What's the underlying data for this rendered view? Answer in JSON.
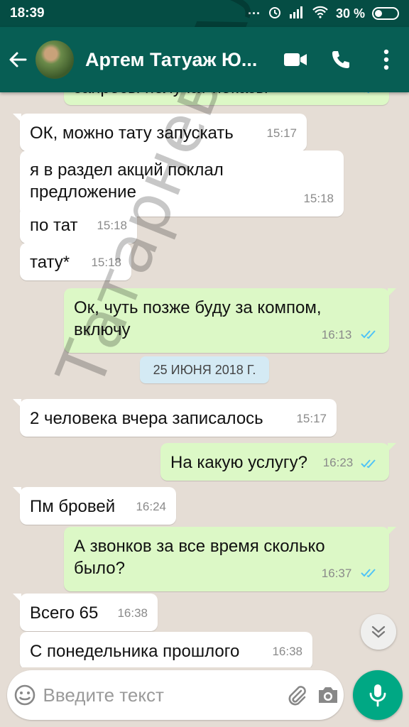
{
  "status_bar": {
    "time": "18:39",
    "battery": "30 %"
  },
  "header": {
    "contact_name": "Артем Татуаж Ю..."
  },
  "partial_top_message": "запросы получат показы",
  "messages": [
    {
      "text": "ОК, можно тату запускать",
      "time": "15:17"
    },
    {
      "text": "я в раздел акций поклал предложение",
      "time": "15:18"
    },
    {
      "text": "по тат",
      "time": "15:18"
    },
    {
      "text": "тату*",
      "time": "15:18"
    },
    {
      "text": "Ок, чуть позже буду за компом, включу",
      "time": "16:13"
    },
    {
      "text": "2 человека вчера записалось",
      "time": "15:17"
    },
    {
      "text": "На какую услугу?",
      "time": "16:23"
    },
    {
      "text": "Пм бровей",
      "time": "16:24"
    },
    {
      "text": "А звонков за все время сколько было?",
      "time": "16:37"
    },
    {
      "text": "Всего 65",
      "time": "16:38"
    },
    {
      "text": "С понедельника прошлого",
      "time": "16:38"
    }
  ],
  "date_separator": "25 ИЮНЯ 2018 Г.",
  "watermark": "Татарнев Алексей",
  "input": {
    "placeholder": "Введите текст"
  },
  "colors": {
    "header": "#075e54",
    "status": "#054d44",
    "outgoing": "#dcf8c6",
    "incoming": "#ffffff",
    "accent": "#00a884",
    "ticks": "#4fc3f7"
  }
}
